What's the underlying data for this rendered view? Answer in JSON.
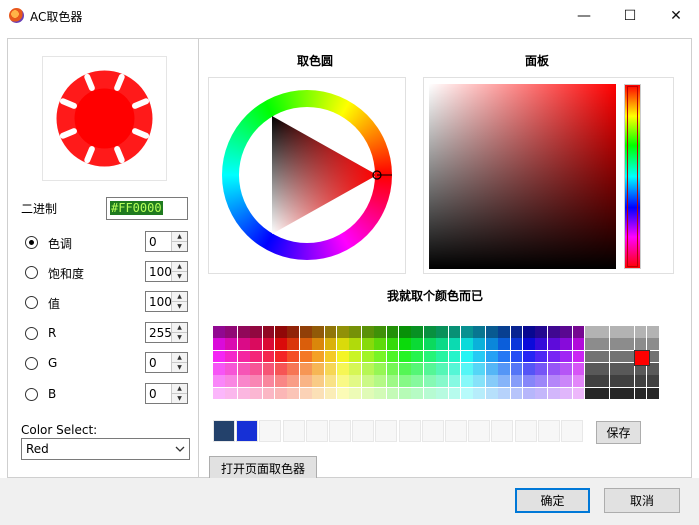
{
  "window": {
    "title": "AC取色器",
    "minimize_glyph": "—",
    "maximize_glyph": "☐",
    "close_glyph": "✕"
  },
  "hex": {
    "label": "二进制",
    "value": "#FF0000"
  },
  "controls": [
    {
      "name": "hue",
      "label": "色调",
      "value": "0",
      "selected": true
    },
    {
      "name": "saturation",
      "label": "饱和度",
      "value": "100",
      "selected": false
    },
    {
      "name": "value",
      "label": "值",
      "value": "100",
      "selected": false
    },
    {
      "name": "r",
      "label": "R",
      "value": "255",
      "selected": false
    },
    {
      "name": "g",
      "label": "G",
      "value": "0",
      "selected": false
    },
    {
      "name": "b",
      "label": "B",
      "value": "0",
      "selected": false
    }
  ],
  "color_select": {
    "label": "Color Select:",
    "value": "Red"
  },
  "wheel": {
    "title": "取色圆"
  },
  "board": {
    "title": "面板"
  },
  "palette": {
    "title": "我就取个颜色而已"
  },
  "saved": {
    "colors": [
      "#23416b",
      "#1630d6"
    ],
    "save_label": "保存"
  },
  "open_page_picker_label": "打开页面取色器",
  "ok_label": "确定",
  "cancel_label": "取消",
  "colors": {
    "selected": "#ff0000",
    "accent": "#0078d7"
  }
}
